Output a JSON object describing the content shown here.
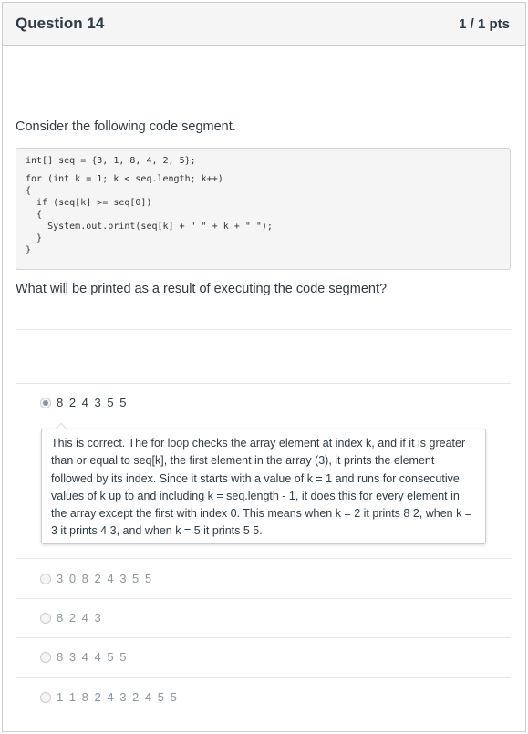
{
  "header": {
    "title": "Question 14",
    "points": "1 / 1 pts"
  },
  "prompt": "Consider the following code segment.",
  "code_lines": [
    "int[] seq = {3, 1, 8, 4, 2, 5};",
    "for (int k = 1; k < seq.length; k++)",
    "{",
    "  if (seq[k] >= seq[0])",
    "  {",
    "    System.out.print(seq[k] + \" \" + k + \" \");",
    "  }",
    "}"
  ],
  "question_text": "What will be printed as a result of executing the code segment?",
  "answers": [
    {
      "label": "8 2 4 3 5 5",
      "selected": true
    },
    {
      "label": "3 0 8 2 4 3 5 5",
      "selected": false
    },
    {
      "label": "8 2 4 3",
      "selected": false
    },
    {
      "label": "8 3 4 4 5 5",
      "selected": false
    },
    {
      "label": "1 1 8 2 4 3 2 4 5 5",
      "selected": false
    }
  ],
  "feedback": "This is correct. The for loop checks the array element at index k, and if it is greater than or equal to seq[k], the first element in the array (3), it prints the element followed by its index. Since it starts with a value of k = 1 and runs for consecutive values of k up to and including k = seq.length - 1, it does this for every element in the array except the first with index 0. This means when k = 2 it prints 8 2, when k = 3 it prints 4 3, and when k = 5 it prints 5 5.",
  "colors": {
    "header_bg": "#f5f5f5",
    "text": "#2d3b45",
    "muted_text": "#8b969e",
    "border": "#c7cdd1"
  }
}
